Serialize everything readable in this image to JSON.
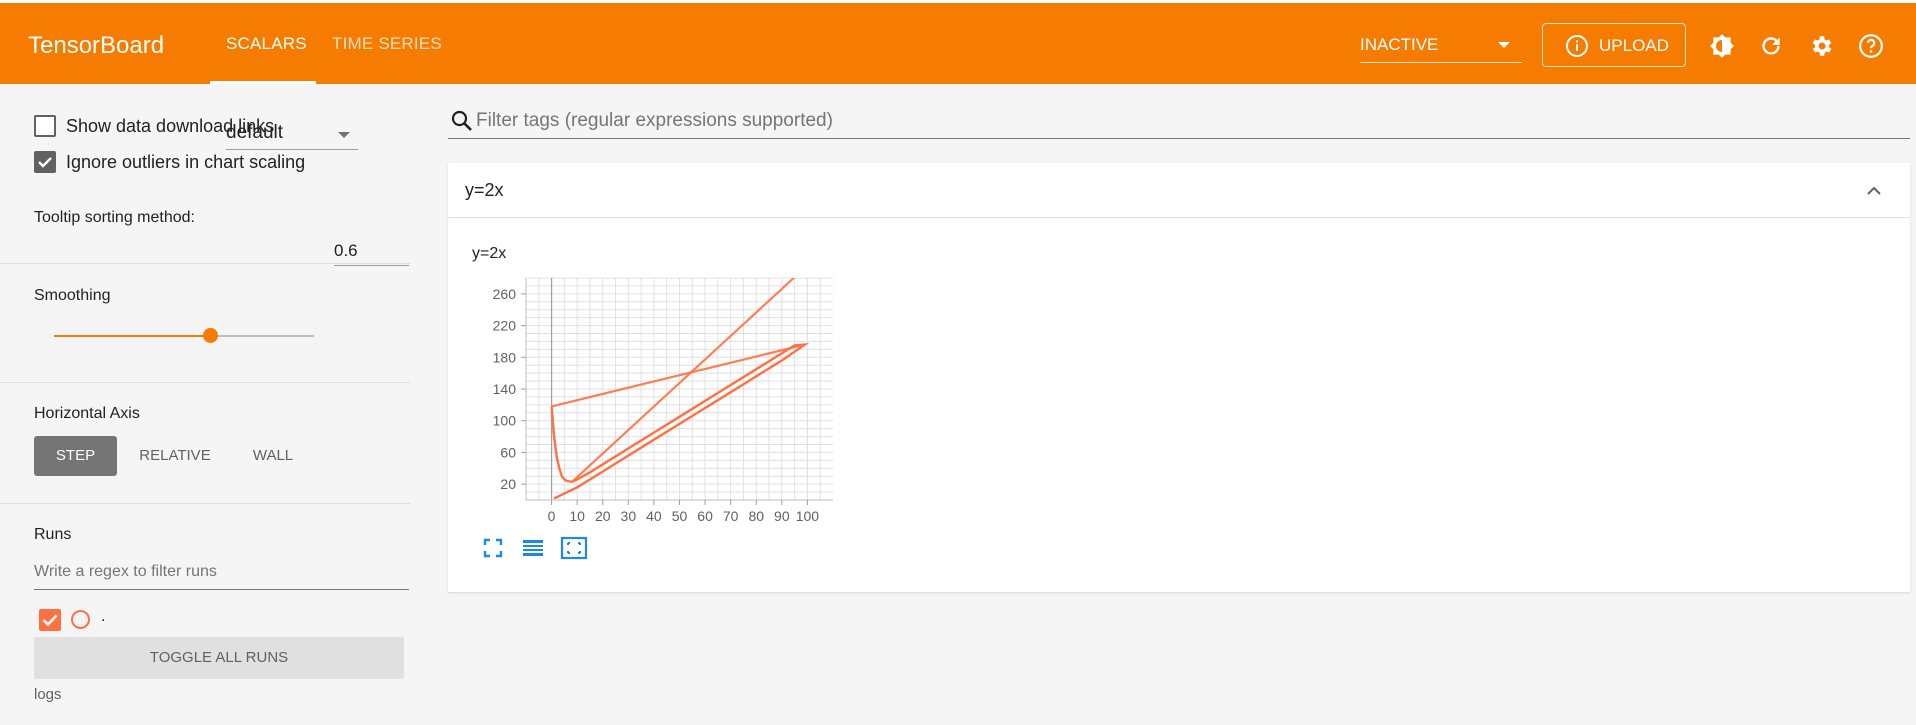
{
  "app": {
    "brand": "TensorBoard",
    "accent_color": "#f57c00",
    "run_color": "#ff7043"
  },
  "header": {
    "tabs": [
      {
        "label": "SCALARS",
        "active": true
      },
      {
        "label": "TIME SERIES",
        "active": false
      }
    ],
    "run_select_value": "INACTIVE",
    "upload_label": "UPLOAD",
    "icons": [
      "info-icon",
      "theme-toggle-icon",
      "reload-icon",
      "settings-icon",
      "help-icon"
    ]
  },
  "sidebar": {
    "show_download_links": {
      "label": "Show data download links",
      "checked": false
    },
    "ignore_outliers": {
      "label": "Ignore outliers in chart scaling",
      "checked": true
    },
    "tooltip_sorting": {
      "label": "Tooltip sorting method:",
      "value": "default"
    },
    "smoothing": {
      "label": "Smoothing",
      "value": "0.6",
      "fraction": 0.6
    },
    "horizontal_axis": {
      "label": "Horizontal Axis",
      "options": [
        "STEP",
        "RELATIVE",
        "WALL"
      ],
      "selected": "STEP"
    },
    "runs": {
      "label": "Runs",
      "filter_placeholder": "Write a regex to filter runs",
      "items": [
        {
          "name": ".",
          "checked": true
        }
      ],
      "toggle_all_label": "TOGGLE ALL RUNS",
      "logdir": "logs"
    }
  },
  "main": {
    "filter_placeholder": "Filter tags (regular expressions supported)",
    "card": {
      "title": "y=2x",
      "chart_title": "y=2x"
    },
    "chart_tools": [
      "fit-to-data-icon",
      "data-table-icon",
      "zoom-region-icon"
    ]
  },
  "chart_data": {
    "type": "line",
    "title": "y=2x",
    "xlim": [
      -10,
      110
    ],
    "ylim": [
      0,
      280
    ],
    "x_ticks": [
      0,
      10,
      20,
      30,
      40,
      50,
      60,
      70,
      80,
      90,
      100
    ],
    "y_ticks": [
      20,
      60,
      100,
      140,
      180,
      220,
      260
    ],
    "grid": true,
    "series": [
      {
        "role": "smoothed",
        "x": [
          0,
          1,
          2,
          3,
          4,
          5,
          6,
          8,
          10,
          15,
          20,
          30,
          40,
          50,
          60,
          70,
          80,
          90,
          95,
          99,
          90,
          80,
          70,
          60,
          50,
          40,
          30,
          20,
          10,
          1
        ],
        "y": [
          118,
          80,
          55,
          40,
          30,
          26,
          24,
          23,
          26,
          35,
          45,
          65,
          85,
          105,
          125,
          145,
          165,
          185,
          195,
          196,
          176,
          156,
          136,
          116,
          96,
          76,
          56,
          36,
          16,
          2
        ]
      },
      {
        "role": "raw",
        "x": [
          0,
          99
        ],
        "y": [
          118,
          196
        ]
      },
      {
        "role": "raw",
        "x": [
          8,
          95
        ],
        "y": [
          23,
          281
        ]
      }
    ]
  }
}
